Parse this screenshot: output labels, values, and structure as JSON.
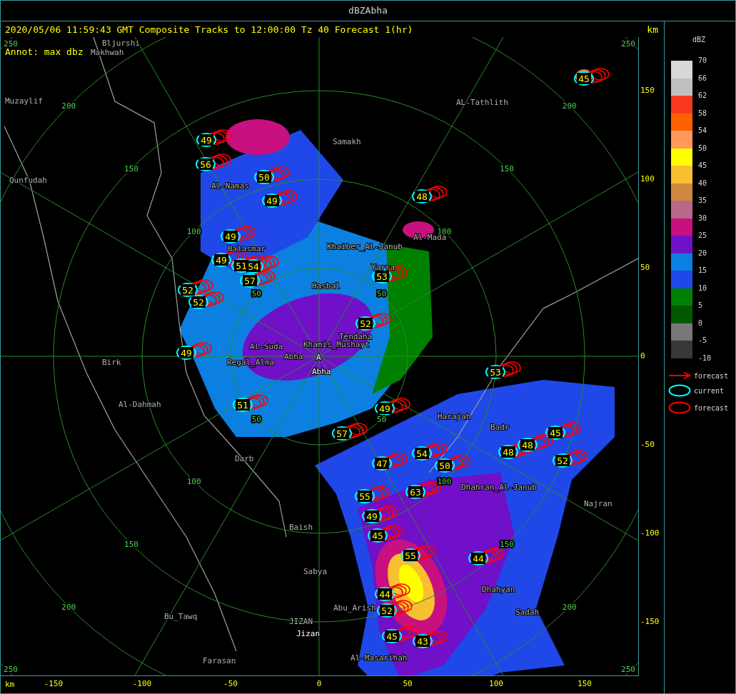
{
  "window": {
    "title": "dBZAbha"
  },
  "header": {
    "caption": "2020/05/06 11:59:43 GMT Composite Tracks to 12:00:00 Tz 40 Forecast 1(hr)",
    "unit": "km"
  },
  "map": {
    "annotation": "Annot: max dbz",
    "range_labels": [
      "250",
      "250",
      "200",
      "200",
      "150",
      "150",
      "100",
      "100",
      "50",
      "50",
      "50",
      "50",
      "100",
      "100",
      "150",
      "150",
      "200",
      "200",
      "250",
      "250"
    ],
    "cities": [
      {
        "name": "Bljurshi",
        "kind": "city"
      },
      {
        "name": "Makhwah",
        "kind": "city"
      },
      {
        "name": "Muzaylif",
        "kind": "city"
      },
      {
        "name": "AL-Tathlith",
        "kind": "city"
      },
      {
        "name": "Samakh",
        "kind": "city"
      },
      {
        "name": "Qunfudah",
        "kind": "city"
      },
      {
        "name": "Al-Namas",
        "kind": "city"
      },
      {
        "name": "Balasmar",
        "kind": "city"
      },
      {
        "name": "Khaiber_Al-Janub",
        "kind": "city"
      },
      {
        "name": "Al-Mada",
        "kind": "city"
      },
      {
        "name": "Yarra",
        "kind": "city"
      },
      {
        "name": "Hasbal",
        "kind": "city"
      },
      {
        "name": "Tendaha",
        "kind": "city"
      },
      {
        "name": "Al-Suda",
        "kind": "city"
      },
      {
        "name": "Khamis_Mushayt",
        "kind": "city"
      },
      {
        "name": "Birk",
        "kind": "city"
      },
      {
        "name": "Regal_Alma",
        "kind": "city"
      },
      {
        "name": "Abha",
        "kind": "city"
      },
      {
        "name": "A",
        "kind": "site"
      },
      {
        "name": "Abha",
        "kind": "site"
      },
      {
        "name": "Al-Dahmah",
        "kind": "city"
      },
      {
        "name": "Harajah",
        "kind": "city"
      },
      {
        "name": "Badr",
        "kind": "city"
      },
      {
        "name": "Darb",
        "kind": "city"
      },
      {
        "name": "Dhahran_Al-Janub",
        "kind": "city"
      },
      {
        "name": "Najran",
        "kind": "city"
      },
      {
        "name": "Baish",
        "kind": "city"
      },
      {
        "name": "Sabya",
        "kind": "city"
      },
      {
        "name": "Dhahyan",
        "kind": "city"
      },
      {
        "name": "Bu_Tawq",
        "kind": "city"
      },
      {
        "name": "JIZAN",
        "kind": "city"
      },
      {
        "name": "Abu_Arish",
        "kind": "city"
      },
      {
        "name": "Sadah",
        "kind": "city"
      },
      {
        "name": "Jizan",
        "kind": "site"
      },
      {
        "name": "Farasan",
        "kind": "city"
      },
      {
        "name": "Al-Masarihah",
        "kind": "city"
      }
    ],
    "cells": [
      {
        "label": "45"
      },
      {
        "label": "49"
      },
      {
        "label": "56"
      },
      {
        "label": "50"
      },
      {
        "label": "49"
      },
      {
        "label": "48"
      },
      {
        "label": "49"
      },
      {
        "label": "49"
      },
      {
        "label": "51"
      },
      {
        "label": "54"
      },
      {
        "label": "57"
      },
      {
        "label": "53"
      },
      {
        "label": "52"
      },
      {
        "label": "52"
      },
      {
        "label": "52"
      },
      {
        "label": "49"
      },
      {
        "label": "53"
      },
      {
        "label": "51"
      },
      {
        "label": "49"
      },
      {
        "label": "57"
      },
      {
        "label": "45"
      },
      {
        "label": "54"
      },
      {
        "label": "48"
      },
      {
        "label": "48"
      },
      {
        "label": "47"
      },
      {
        "label": "50"
      },
      {
        "label": "52"
      },
      {
        "label": "55"
      },
      {
        "label": "63"
      },
      {
        "label": "49"
      },
      {
        "label": "45"
      },
      {
        "label": "55"
      },
      {
        "label": "44"
      },
      {
        "label": "44"
      },
      {
        "label": "52"
      },
      {
        "label": "45"
      },
      {
        "label": "43"
      }
    ]
  },
  "x_axis": {
    "unit": "km",
    "ticks": [
      "-150",
      "-100",
      "-50",
      "0",
      "50",
      "100",
      "150"
    ]
  },
  "y_axis": {
    "ticks": [
      "150",
      "100",
      "50",
      "0",
      "-50",
      "-100",
      "-150"
    ]
  },
  "legend": {
    "title": "dBZ",
    "labels": [
      "70",
      "66",
      "62",
      "58",
      "54",
      "50",
      "45",
      "40",
      "35",
      "30",
      "25",
      "20",
      "15",
      "10",
      "5",
      "0",
      "-5",
      "-10"
    ],
    "swatches": [
      {
        "color": "#d8d8d8"
      },
      {
        "color": "#c0c0c0"
      },
      {
        "color": "#f83820"
      },
      {
        "color": "#ff6000"
      },
      {
        "color": "#ff9858"
      },
      {
        "color": "#ffff00"
      },
      {
        "color": "#f8c030"
      },
      {
        "color": "#d08840"
      },
      {
        "color": "#b86888"
      },
      {
        "color": "#c81080"
      },
      {
        "color": "#7010c8"
      },
      {
        "color": "#0c80e0"
      },
      {
        "color": "#2048e8"
      },
      {
        "color": "#008000"
      },
      {
        "color": "#005800"
      },
      {
        "color": "#787878"
      },
      {
        "color": "#383838"
      }
    ],
    "items": [
      {
        "kind": "arrow",
        "color": "#ff0000",
        "label": "forecast"
      },
      {
        "kind": "ellipse",
        "color": "#00ffff",
        "label": "current"
      },
      {
        "kind": "ellipse",
        "color": "#ff0000",
        "label": "forecast"
      }
    ]
  }
}
